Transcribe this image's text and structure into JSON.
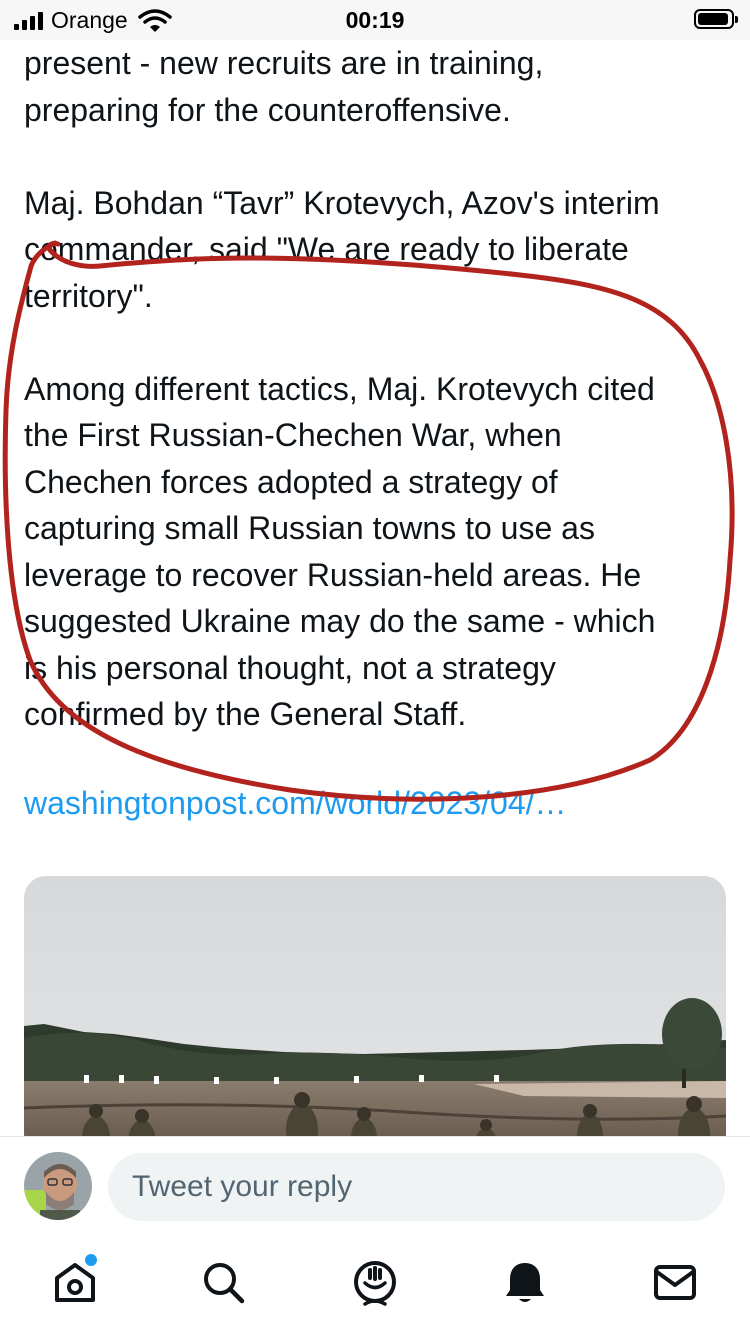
{
  "status_bar": {
    "carrier": "Orange",
    "time": "00:19"
  },
  "tweet": {
    "lines_p1": [
      "present - new recruits are in training,",
      "preparing for the counteroffensive."
    ],
    "lines_p2": [
      "Maj. Bohdan “Tavr” Krotevych, Azov's interim",
      "commander, said \"We are ready to liberate",
      "territory\"."
    ],
    "lines_p3": [
      "Among different tactics, Maj. Krotevych cited",
      "the First Russian-Chechen War, when",
      "Chechen forces adopted a strategy of",
      "capturing small Russian towns to use as",
      "leverage to recover Russian-held areas. He",
      "suggested Ukraine may do the same - which",
      "is his personal thought, not a strategy",
      "confirmed by the General Staff."
    ],
    "link": "washingtonpost.com/world/2023/04/…"
  },
  "reply": {
    "placeholder": "Tweet your reply"
  },
  "tabs": [
    {
      "icon": "home-icon",
      "label": "Home"
    },
    {
      "icon": "search-icon",
      "label": "Search"
    },
    {
      "icon": "spaces-icon",
      "label": "Spaces"
    },
    {
      "icon": "notifications-icon",
      "label": "Notifications"
    },
    {
      "icon": "messages-icon",
      "label": "Messages"
    }
  ],
  "colors": {
    "accent": "#1d9bf0",
    "annotation": "#b3231d",
    "text": "#0f1419",
    "muted": "#536471"
  }
}
